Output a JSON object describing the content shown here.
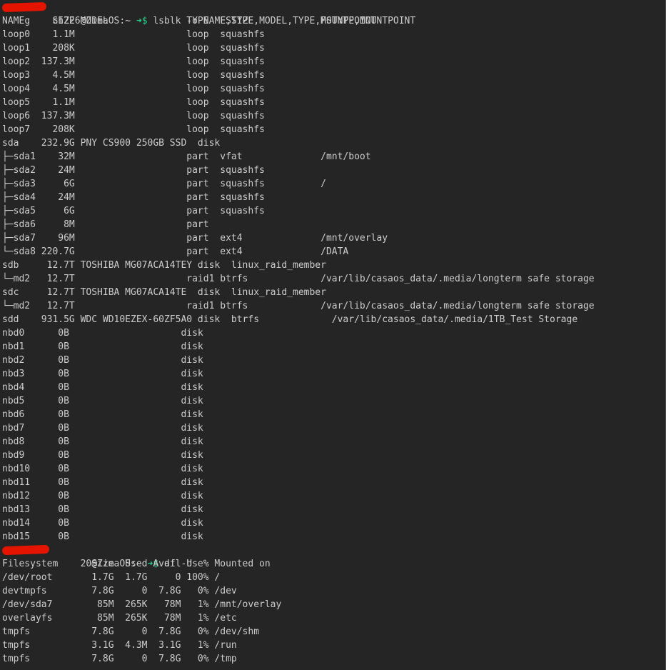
{
  "colors": {
    "background": "#252526",
    "text": "#cccccc",
    "arrow": "#23d18b",
    "redaction": "#e51400"
  },
  "prompt1": {
    "user_visible": "g    ch226",
    "host_suffix": "@ZimaOS:~",
    "arrow": " ➜$ ",
    "command": "lsblk -o NAME,SIZE,MODEL,TYPE,FSTYPE,MOUNTPOINT"
  },
  "lsblk_lines": [
    "NAME     SIZE MODEL              TYPE  FSTYPE            MOUNTPOINT",
    "loop0    1.1M                    loop  squashfs",
    "loop1    208K                    loop  squashfs",
    "loop2  137.3M                    loop  squashfs",
    "loop3    4.5M                    loop  squashfs",
    "loop4    4.5M                    loop  squashfs",
    "loop5    1.1M                    loop  squashfs",
    "loop6  137.3M                    loop  squashfs",
    "loop7    208K                    loop  squashfs",
    "sda    232.9G PNY CS900 250GB SSD  disk",
    "├─sda1    32M                    part  vfat              /mnt/boot",
    "├─sda2    24M                    part  squashfs",
    "├─sda3     6G                    part  squashfs          /",
    "├─sda4    24M                    part  squashfs",
    "├─sda5     6G                    part  squashfs",
    "├─sda6     8M                    part",
    "├─sda7    96M                    part  ext4              /mnt/overlay",
    "└─sda8 220.7G                    part  ext4              /DATA",
    "sdb     12.7T TOSHIBA MG07ACA14TEY disk  linux_raid_member",
    "└─md2   12.7T                    raid1 btrfs             /var/lib/casaos_data/.media/longterm safe storage",
    "sdc     12.7T TOSHIBA MG07ACA14TE  disk  linux_raid_member",
    "└─md2   12.7T                    raid1 btrfs             /var/lib/casaos_data/.media/longterm safe storage",
    "sdd    931.5G WDC WD10EZEX-60ZF5A0 disk  btrfs             /var/lib/casaos_data/.media/1TB_Test Storage",
    "nbd0      0B                    disk",
    "nbd1      0B                    disk",
    "nbd2      0B                    disk",
    "nbd3      0B                    disk",
    "nbd4      0B                    disk",
    "nbd5      0B                    disk",
    "nbd6      0B                    disk",
    "nbd7      0B                    disk",
    "nbd8      0B                    disk",
    "nbd9      0B                    disk",
    "nbd10     0B                    disk",
    "nbd11     0B                    disk",
    "nbd12     0B                    disk",
    "nbd13     0B                    disk",
    "nbd14     0B                    disk",
    "nbd15     0B                    disk"
  ],
  "prompt2": {
    "user_visible": "          20",
    "host_suffix": "@ZimaOS:~",
    "arrow": " ➜$ ",
    "command": "df -h"
  },
  "df_lines": [
    "Filesystem      Size  Used Avail Use% Mounted on",
    "/dev/root       1.7G  1.7G     0 100% /",
    "devtmpfs        7.8G     0  7.8G   0% /dev",
    "/dev/sda7        85M  265K   78M   1% /mnt/overlay",
    "overlayfs        85M  265K   78M   1% /etc",
    "tmpfs           7.8G     0  7.8G   0% /dev/shm",
    "tmpfs           3.1G  4.3M  3.1G   1% /run",
    "tmpfs           7.8G     0  7.8G   0% /tmp"
  ]
}
